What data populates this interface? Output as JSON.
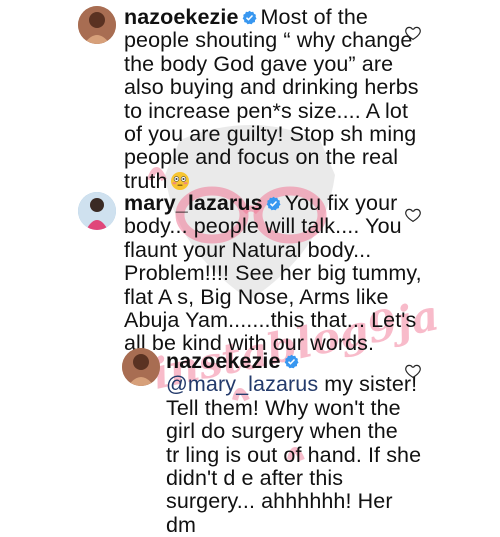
{
  "comments": [
    {
      "username": "nazoekezie",
      "text": "Most of the\npeople shouting “ why change\nthe body God gave you” are\nalso buying and drinking herbs\nto increase pen*s size.... A lot\nof you are guilty! Stop sh  ming\npeople and focus on the real\ntruth",
      "emoji": "flushed-face-emoji"
    },
    {
      "username": "mary_lazarus",
      "text": "You fix your\nbody... people will talk.... You\nflaunt your Natural body...\nProblem!!!! See her big tummy,\nflat A  s, Big Nose, Arms like\nAbuja Yam.......this that... Let's\nall be kind with our words."
    },
    {
      "username": "nazoekezie",
      "mention": "@mary_lazarus",
      "text": " my sister!\nTell them! Why won't the\ngirl do surgery when the\ntr  ling is out of hand. If she\ndidn't d e after this\nsurgery... ahhhhhh! Her dm"
    }
  ],
  "watermark": {
    "text": "instablog9ja",
    "color": "#f06a8c"
  },
  "icons": {
    "verified": "verified-badge-icon",
    "like": "heart-outline-icon"
  }
}
